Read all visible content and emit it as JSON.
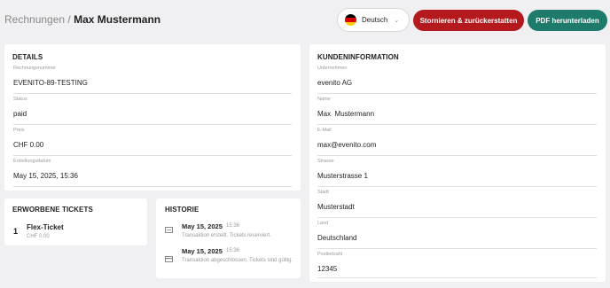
{
  "header": {
    "breadcrumb_parent": "Rechnungen",
    "breadcrumb_separator": "/",
    "breadcrumb_current": "Max Mustermann",
    "language": {
      "label": "Deutsch",
      "flag_icon": "germany-flag-icon"
    },
    "cancel_refund_label": "Stornieren & zurückerstatten",
    "download_pdf_label": "PDF herunterladen"
  },
  "colors": {
    "danger": "#b3191d",
    "primary": "#1e7a6a",
    "background": "#f0f0f2"
  },
  "details": {
    "title": "DETAILS",
    "fields": [
      {
        "label": "Rechnungsnummer",
        "value": "EVENITO-89-TESTING"
      },
      {
        "label": "Status",
        "value": "paid"
      },
      {
        "label": "Preis",
        "value": "CHF 0.00"
      },
      {
        "label": "Erstellungsdatum",
        "value": "May 15, 2025, 15:36"
      }
    ]
  },
  "customer": {
    "title": "KUNDENINFORMATION",
    "fields": [
      {
        "label": "Unternehmen",
        "value": "evenito AG"
      },
      {
        "label": "Name",
        "value": "Max  Mustermann"
      },
      {
        "label": "E-Mail",
        "value": "max@evenito.com"
      },
      {
        "label": "Strasse",
        "value": "Musterstrasse 1"
      },
      {
        "label": "Stadt",
        "value": "Musterstadt"
      },
      {
        "label": "Land",
        "value": "Deutschland"
      },
      {
        "label": "Postleitzahl",
        "value": "12345"
      }
    ]
  },
  "tickets": {
    "title": "ERWORBENE TICKETS",
    "items": [
      {
        "quantity": "1",
        "name": "Flex-Ticket",
        "price": "CHF 0.00"
      }
    ]
  },
  "history": {
    "title": "HISTORIE",
    "items": [
      {
        "icon": "receipt-icon",
        "date": "May 15, 2025",
        "time": "15:36",
        "description": "Transaktion erstellt. Tickets reserviert."
      },
      {
        "icon": "credit-card-icon",
        "date": "May 15, 2025",
        "time": "15:36",
        "description": "Transaktion abgeschlossen. Tickets sind gültig."
      }
    ]
  }
}
